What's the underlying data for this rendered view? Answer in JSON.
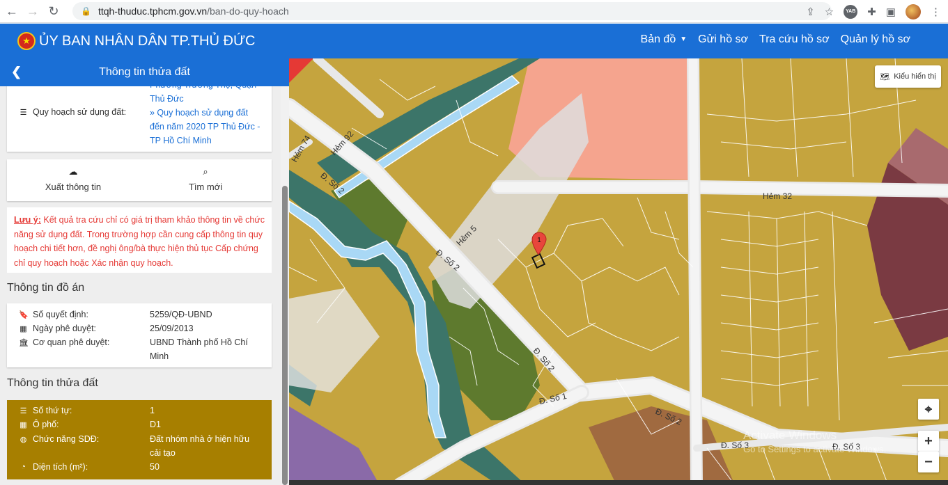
{
  "browser": {
    "url_host": "ttqh-thuduc.tphcm.gov.vn",
    "url_path": "/ban-do-quy-hoach",
    "extension_badge": "YAB"
  },
  "header": {
    "title": "ỦY BAN NHÂN DÂN TP.THỦ ĐỨC",
    "nav": [
      "Bản đồ",
      "Gửi hồ sơ",
      "Tra cứu hồ sơ",
      "Quản lý hồ sơ"
    ]
  },
  "panel": {
    "title": "Thông tin thửa đất",
    "top_card": {
      "partial_text_1": "Phường Trường Thọ, Quận",
      "partial_text_2": "Thủ Đức",
      "label": "Quy hoạch sử dụng đất:",
      "value_line1": "» Quy hoạch sử dụng đất",
      "value_line2": "đến năm 2020 TP Thủ Đức -",
      "value_line3": "TP Hồ Chí Minh"
    },
    "actions": {
      "export": "Xuất thông tin",
      "search": "Tìm mới"
    },
    "note": {
      "label": "Lưu ý:",
      "text": " Kết quả tra cứu chỉ có giá trị tham khảo thông tin về chức năng sử dụng đất. Trong trường hợp cần cung cấp thông tin quy hoạch chi tiết hơn, đề nghị ông/bà thực hiện thủ tục Cấp chứng chỉ quy hoạch hoặc Xác nhận quy hoạch."
    },
    "project": {
      "title": "Thông tin đồ án",
      "decision_label": "Số quyết định:",
      "decision_value": "5259/QĐ-UBND",
      "date_label": "Ngày phê duyệt:",
      "date_value": "25/09/2013",
      "agency_label": "Cơ quan phê duyệt:",
      "agency_value_1": "UBND Thành phố Hồ Chí",
      "agency_value_2": "Minh"
    },
    "land": {
      "title": "Thông tin thửa đất",
      "order_label": "Số thứ tự:",
      "order_value": "1",
      "block_label": "Ô phố:",
      "block_value": "D1",
      "function_label": "Chức năng SDĐ:",
      "function_value_1": "Đất nhóm nhà ở hiện hữu",
      "function_value_2": "cải tạo",
      "area_label": "Diện tích (m²):",
      "area_value": "50"
    }
  },
  "map": {
    "style_button": "Kiểu hiển thị",
    "marker_label": "1",
    "zoom_in": "+",
    "zoom_out": "−",
    "road_labels": {
      "so2_a": "Đ. Số 2",
      "so2_b": "Đ. Số 2",
      "so2_c": "Đ. Số 2",
      "so1": "Đ. Số 1",
      "so2_d": "Đ. Số 2",
      "so3": "Đ. Số 3",
      "so3_b": "Đ. Số 3",
      "hem92": "Hẻm 92",
      "hem74": "Hẻm 74",
      "hem32": "Hẻm 32",
      "hem_short": "Hẻm 5"
    },
    "watermark_1": "Activate Windows",
    "watermark_2": "Go to Settings to activate Windows."
  },
  "colors": {
    "header_blue": "#1a6fd6",
    "residential": "#c5a43e",
    "park_dark": "#5e7a2e",
    "water": "#a9d8f5",
    "greenbelt": "#3c7569",
    "salmon": "#f5a48e",
    "maroon": "#7a3a42",
    "purple": "#8a6aa8",
    "brown": "#a06a40",
    "land_card": "#a77f00",
    "note_red": "#e53935"
  }
}
